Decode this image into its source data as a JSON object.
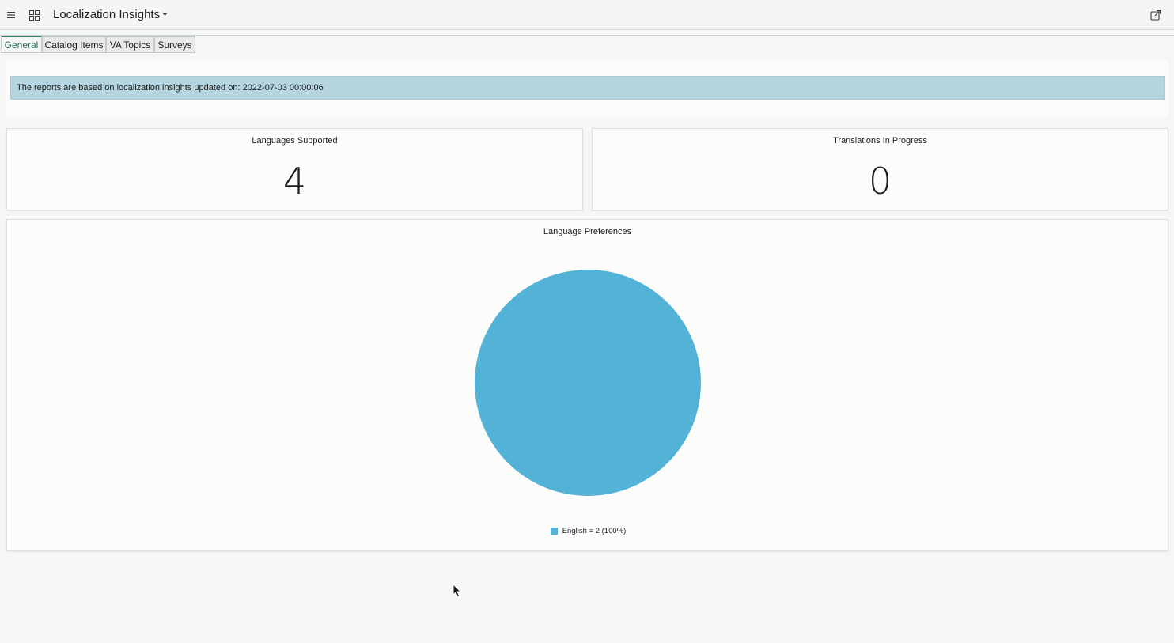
{
  "header": {
    "title": "Localization Insights"
  },
  "tabs": [
    {
      "label": "General",
      "active": true
    },
    {
      "label": "Catalog Items",
      "active": false
    },
    {
      "label": "VA Topics",
      "active": false
    },
    {
      "label": "Surveys",
      "active": false
    }
  ],
  "banner": {
    "text": "The reports are based on localization insights updated on: 2022-07-03 00:00:06"
  },
  "stats": {
    "languages_supported": {
      "title": "Languages Supported",
      "value": "4"
    },
    "translations_in_progress": {
      "title": "Translations In Progress",
      "value": "0"
    }
  },
  "chart_card": {
    "title": "Language Preferences"
  },
  "chart_data": {
    "type": "pie",
    "title": "Language Preferences",
    "categories": [
      "English"
    ],
    "values": [
      2
    ],
    "percentages": [
      100
    ],
    "colors": [
      "#53b3d6"
    ],
    "legend": [
      {
        "label": "English = 2 (100%)",
        "color": "#53b3d6"
      }
    ],
    "legend_position": "bottom"
  },
  "icons": {
    "menu": "hamburger-icon",
    "apps": "grid-icon",
    "title_dropdown": "caret-down-icon",
    "share": "share-external-icon"
  }
}
